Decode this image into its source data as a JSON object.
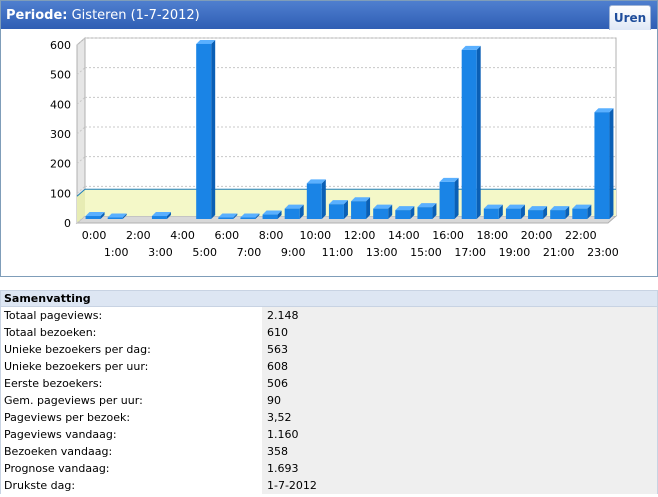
{
  "header": {
    "periode_label": "Periode:",
    "periode_value": "Gisteren (1-7-2012)",
    "tab_label": "Uren"
  },
  "colors": {
    "bar": "#1a84e6",
    "bar_dark": "#0a5fb5",
    "bar_top": "#5ab0ff",
    "average_band": "#f4f8c8",
    "average_line": "#1e7fb8"
  },
  "chart_data": {
    "type": "bar",
    "categories": [
      "0:00",
      "1:00",
      "2:00",
      "3:00",
      "4:00",
      "5:00",
      "6:00",
      "7:00",
      "8:00",
      "9:00",
      "10:00",
      "11:00",
      "12:00",
      "13:00",
      "14:00",
      "15:00",
      "16:00",
      "17:00",
      "18:00",
      "19:00",
      "20:00",
      "21:00",
      "22:00",
      "23:00"
    ],
    "values": [
      10,
      5,
      0,
      10,
      0,
      590,
      5,
      5,
      15,
      35,
      120,
      50,
      60,
      35,
      30,
      40,
      125,
      570,
      35,
      35,
      30,
      30,
      35,
      360
    ],
    "average": 90,
    "ylim": [
      0,
      600
    ],
    "yticks": [
      0,
      100,
      200,
      300,
      400,
      500,
      600
    ],
    "grid": true
  },
  "summary": {
    "title": "Samenvatting",
    "rows": [
      {
        "label": "Totaal pageviews:",
        "value": "2.148"
      },
      {
        "label": "Totaal bezoeken:",
        "value": "610"
      },
      {
        "label": "Unieke bezoekers per dag:",
        "value": "563"
      },
      {
        "label": "Unieke bezoekers per uur:",
        "value": "608"
      },
      {
        "label": "Eerste bezoekers:",
        "value": "506"
      },
      {
        "label": "Gem. pageviews per uur:",
        "value": "90"
      },
      {
        "label": "Pageviews per bezoek:",
        "value": "3,52"
      },
      {
        "label": "Pageviews vandaag:",
        "value": "1.160"
      },
      {
        "label": "Bezoeken vandaag:",
        "value": "358"
      },
      {
        "label": "Prognose vandaag:",
        "value": "1.693"
      },
      {
        "label": "Drukste dag:",
        "value": "1-7-2012"
      }
    ]
  }
}
